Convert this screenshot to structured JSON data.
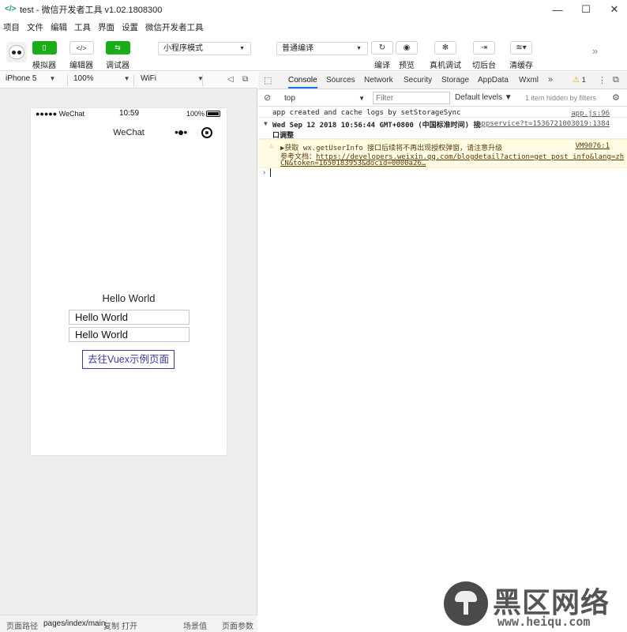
{
  "window": {
    "title": "test - 微信开发者工具 v1.02.1808300",
    "minimize_glyph": "—",
    "maximize_glyph": "☐",
    "close_glyph": "✕"
  },
  "menu": [
    "项目",
    "文件",
    "编辑",
    "工具",
    "界面",
    "设置",
    "微信开发者工具"
  ],
  "toolbar": {
    "simulator": "模拟器",
    "editor": "编辑器",
    "debugger": "调试器",
    "mode_select": "小程序模式",
    "compile_select": "普通编译",
    "compile": "编译",
    "preview": "预览",
    "device_debug": "真机调试",
    "background": "切后台",
    "clear_cache": "清缓存"
  },
  "simulator": {
    "device": "iPhone 5",
    "zoom": "100%",
    "network": "WiFi",
    "status": {
      "signal": "●●●●● WeChat",
      "time": "10:59",
      "battery": "100%"
    },
    "nav_title": "WeChat",
    "nav_more": "•●•",
    "hello_text": "Hello World",
    "input1_value": "Hello World",
    "input2_value": "Hello World",
    "button_label": "去往Vuex示例页面"
  },
  "pathbar": {
    "label": "页面路径",
    "path": "pages/index/main",
    "copy": "复制",
    "open": "打开",
    "scene": "场景值",
    "params": "页面参数"
  },
  "devtools": {
    "tabs": [
      "Console",
      "Sources",
      "Network",
      "Security",
      "Storage",
      "AppData",
      "Wxml"
    ],
    "more_tabs": "»",
    "warning_count": "1",
    "context": "top",
    "filter_placeholder": "Filter",
    "levels": "Default levels ▼",
    "hidden_info": "1 item hidden by filters"
  },
  "console": {
    "row1_text": "app created and cache logs by setStorageSync",
    "row1_src": "app.js:96",
    "row2_line1": "Wed Sep 12 2018 10:56:44 GMT+0800 (中国标准时间) 接",
    "row2_line2": "口调整",
    "row2_src": "appservice?t=1536721003019:1384",
    "row3_line1": "▶获取 wx.getUserInfo 接口后续将不再出现授权弹窗，请注意升级",
    "row3_line2_prefix": "参考文档：",
    "row3_link1": "https://developers.weixin.qq.com/blogdetail?action=get_post_info&lang=zh",
    "row3_link2": "CN&token=1650183953&docid=0000a26…",
    "row3_src": "VM9076:1",
    "prompt": "›"
  },
  "watermark": {
    "main": "黑区网络",
    "url": "www.heiqu.com"
  }
}
